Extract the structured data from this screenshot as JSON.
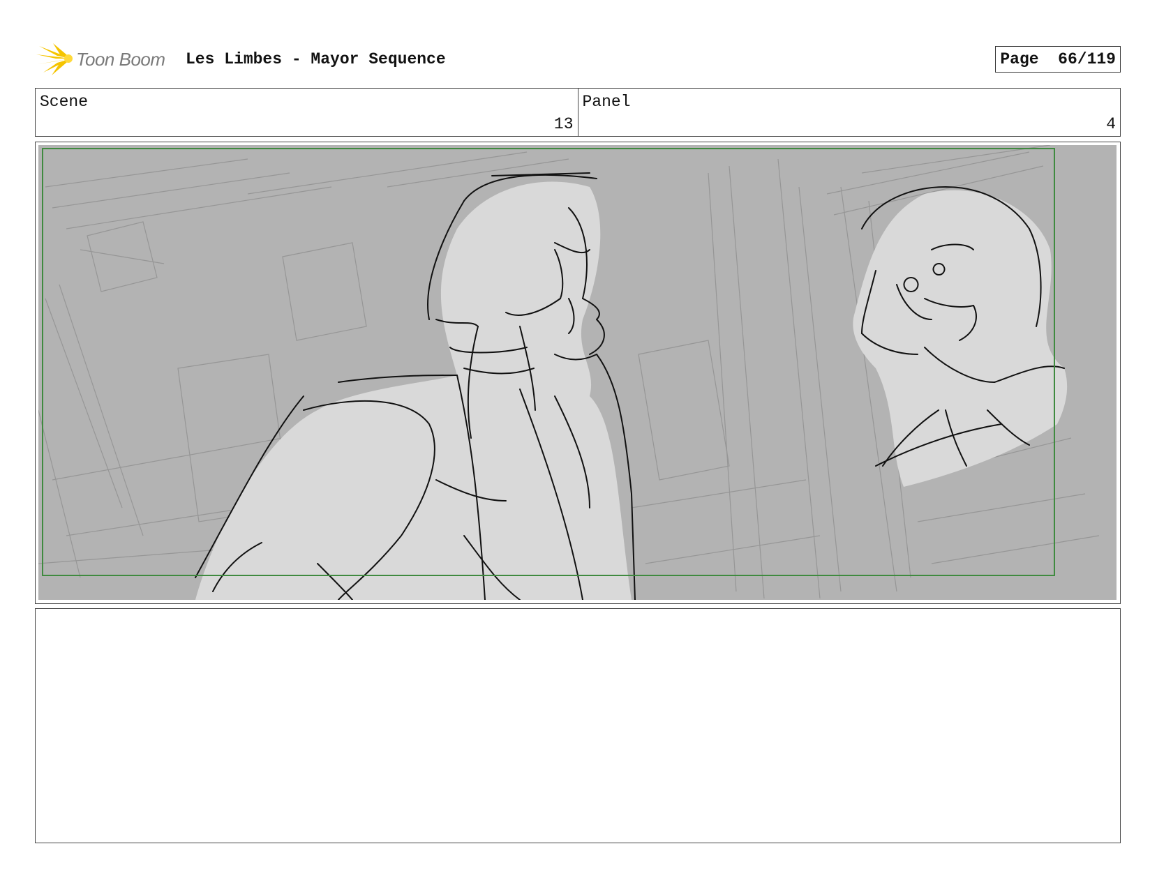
{
  "header": {
    "logo_text": "Toon Boom",
    "title": "Les Limbes - Mayor Sequence",
    "page_label": "Page",
    "page_number": "66/119"
  },
  "info": {
    "scene_label": "Scene",
    "scene_value": "13",
    "panel_label": "Panel",
    "panel_value": "4"
  },
  "panel": {
    "description": "",
    "safe_frame_color": "#3f8a3f",
    "background_color": "#b3b3b3",
    "figure_fill": "#d9d9d9"
  },
  "notes": {
    "text": ""
  },
  "colors": {
    "logo_accent": "#f5c400",
    "logo_text": "#7a7a7a"
  }
}
